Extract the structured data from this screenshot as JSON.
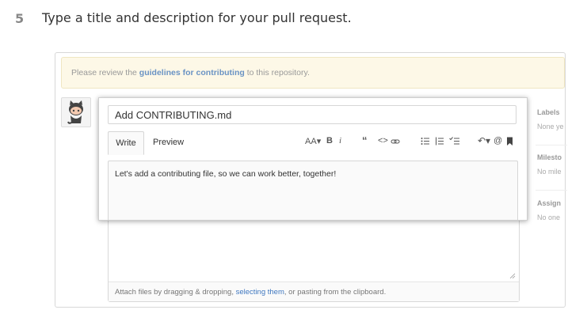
{
  "step": {
    "number": "5",
    "text": "Type a title and description for your pull request."
  },
  "flash": {
    "prefix": "Please review the ",
    "link": "guidelines for contributing",
    "suffix": " to this repository."
  },
  "pr_form": {
    "title_value": "Add CONTRIBUTING.md",
    "tabs": {
      "write": "Write",
      "preview": "Preview"
    },
    "toolbar": {
      "text_size": "AA",
      "bold": "B",
      "italic": "i",
      "quote": "“",
      "code": "<>",
      "ul": "☰",
      "ol": "☰",
      "tasklist": "☰",
      "mention": "@"
    },
    "body_value": "Let's add a contributing file, so we can work better, together!",
    "attach": {
      "prefix": "Attach files by dragging & dropping, ",
      "link": "selecting them",
      "suffix": ", or pasting from the clipboard."
    }
  },
  "sidebar": {
    "labels": {
      "heading": "Labels",
      "value": "None ye"
    },
    "milestone": {
      "heading": "Milesto",
      "value": "No mile"
    },
    "assignees": {
      "heading": "Assign",
      "value": "No one"
    }
  },
  "colors": {
    "link": "#4078c0",
    "flash_bg": "#fdf8e7"
  }
}
